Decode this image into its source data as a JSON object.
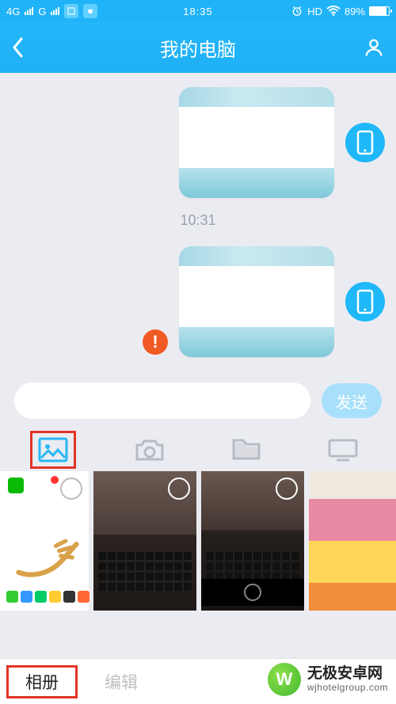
{
  "status": {
    "net_left": "4G",
    "net_right": "G",
    "carrier_icon": "vivo",
    "time": "18:35",
    "hd": "HD",
    "battery_pct": "89%"
  },
  "nav": {
    "title": "我的电脑"
  },
  "chat": {
    "timestamp": "10:31"
  },
  "composer": {
    "send_label": "发送",
    "placeholder": ""
  },
  "tool_tabs": {
    "items": [
      "gallery-icon",
      "camera-icon",
      "folder-icon",
      "monitor-icon"
    ],
    "active_index": 0
  },
  "bottom": {
    "album": "相册",
    "edit": "编辑"
  },
  "watermark": {
    "line1": "无极安卓网",
    "line2": "wjhotelgroup.com"
  },
  "colors": {
    "accent": "#21b3f7",
    "error": "#f15a24",
    "highlight_frame": "#e33425"
  }
}
